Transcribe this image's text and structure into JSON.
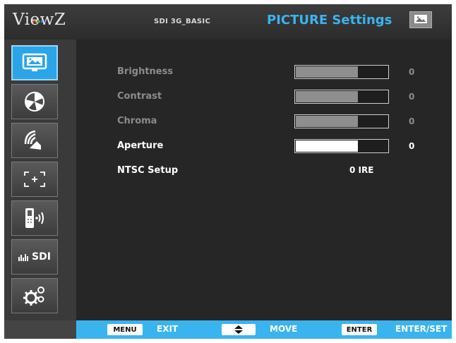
{
  "brand": {
    "logo_text": "ViewZ"
  },
  "header": {
    "profile": "SDI 3G_BASIC",
    "title": "PICTURE Settings",
    "icon": "picture-icon"
  },
  "sidebar": {
    "items": [
      {
        "name": "picture",
        "icon": "picture-icon",
        "active": true
      },
      {
        "name": "color",
        "icon": "color-wheel-icon",
        "active": false
      },
      {
        "name": "audio",
        "icon": "speaker-icon",
        "active": false
      },
      {
        "name": "marker",
        "icon": "marker-icon",
        "active": false
      },
      {
        "name": "remote",
        "icon": "remote-icon",
        "active": false
      },
      {
        "name": "sdi",
        "icon": "waveform-icon",
        "label": "SDI",
        "active": false
      },
      {
        "name": "settings",
        "icon": "gears-icon",
        "active": false
      }
    ]
  },
  "settings": {
    "rows": [
      {
        "label": "Brightness",
        "value": "0",
        "level": 0.68,
        "state": "disabled"
      },
      {
        "label": "Contrast",
        "value": "0",
        "level": 0.68,
        "state": "disabled"
      },
      {
        "label": "Chroma",
        "value": "0",
        "level": 0.68,
        "state": "disabled"
      },
      {
        "label": "Aperture",
        "value": "0",
        "level": 0.68,
        "state": "enabled"
      }
    ],
    "ntsc": {
      "label": "NTSC Setup",
      "value": "0 IRE"
    }
  },
  "footer": {
    "menu_key": "MENU",
    "menu_action": "EXIT",
    "move_key_icon": "up-down-arrows-icon",
    "move_action": "MOVE",
    "enter_key": "ENTER",
    "enter_action": "ENTER/SET"
  },
  "colors": {
    "accent": "#3ab4ef",
    "active_tab": "#2aa5e8",
    "background": "#262626",
    "disabled_text": "#8c8c8c",
    "enabled_text": "#ffffff"
  }
}
